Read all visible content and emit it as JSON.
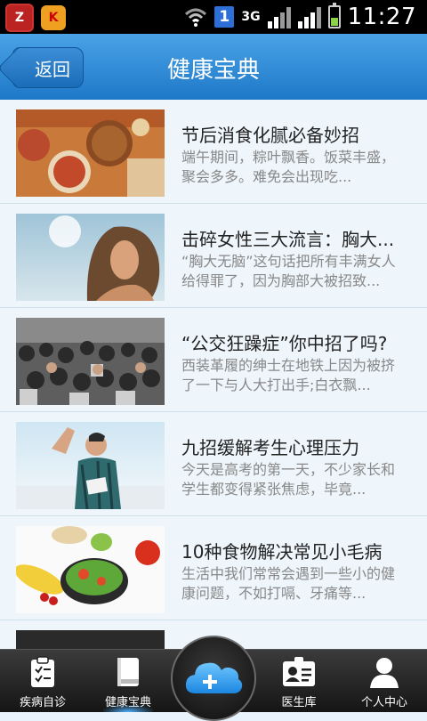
{
  "status_bar": {
    "badge": "1",
    "network": "3G",
    "time": "11:27",
    "battery_level": 0.4
  },
  "header": {
    "back_label": "返回",
    "title": "健康宝典"
  },
  "articles": [
    {
      "title": "节后消食化腻必备妙招",
      "desc": "端午期间，粽叶飘香。饭菜丰盛，聚会多多。难免会出现吃..."
    },
    {
      "title": "击碎女性三大流言：胸大...",
      "desc": "“胸大无脑”这句话把所有丰满女人给得罪了，因为胸部大被招致..."
    },
    {
      "title": "“公交狂躁症”你中招了吗?",
      "desc": "西装革履的绅士在地铁上因为被挤了一下与人大打出手;白衣飘..."
    },
    {
      "title": "九招缓解考生心理压力",
      "desc": "今天是高考的第一天，不少家长和学生都变得紧张焦虑，毕竟..."
    },
    {
      "title": "10种食物解决常见小毛病",
      "desc": "生活中我们常常会遇到一些小的健康问题，不如打嗝、牙痛等..."
    }
  ],
  "tabs": {
    "tab1": "疾病自诊",
    "tab2": "健康宝典",
    "tab3": "医生库",
    "tab4": "个人中心"
  },
  "colors": {
    "header": "#1e78c8",
    "accent": "#2d8fe0",
    "tabbar": "#1e1e1e"
  }
}
